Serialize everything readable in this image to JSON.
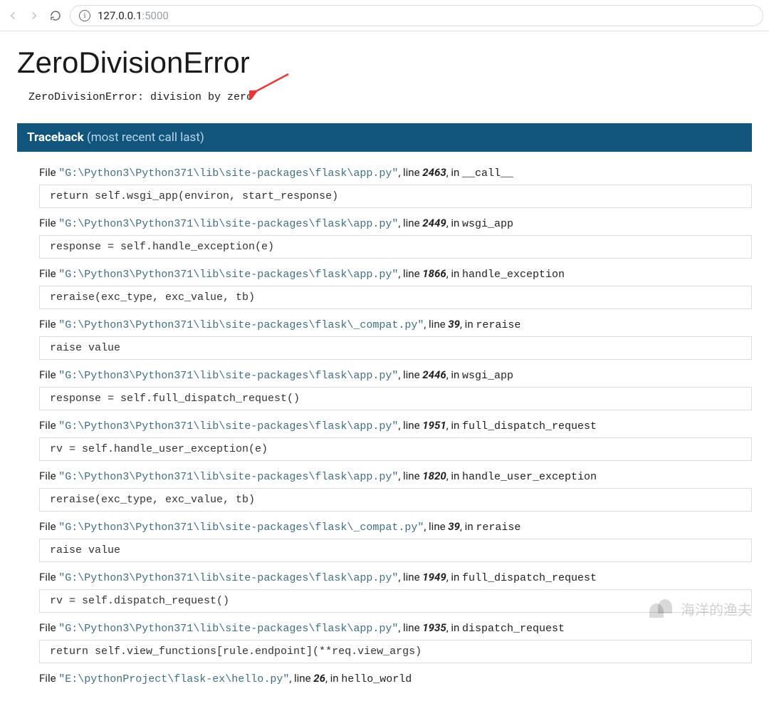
{
  "browser": {
    "url_host": "127.0.0.1",
    "url_port": ":5000"
  },
  "error": {
    "title": "ZeroDivisionError",
    "message": "ZeroDivisionError: division by zero"
  },
  "traceback": {
    "label": "Traceback",
    "paren": "(most recent call last)",
    "frames": [
      {
        "path": "\"G:\\Python3\\Python371\\lib\\site-packages\\flask\\app.py\"",
        "line": "2463",
        "func": "__call__",
        "code": "return self.wsgi_app(environ, start_response)"
      },
      {
        "path": "\"G:\\Python3\\Python371\\lib\\site-packages\\flask\\app.py\"",
        "line": "2449",
        "func": "wsgi_app",
        "code": "response = self.handle_exception(e)"
      },
      {
        "path": "\"G:\\Python3\\Python371\\lib\\site-packages\\flask\\app.py\"",
        "line": "1866",
        "func": "handle_exception",
        "code": "reraise(exc_type, exc_value, tb)"
      },
      {
        "path": "\"G:\\Python3\\Python371\\lib\\site-packages\\flask\\_compat.py\"",
        "line": "39",
        "func": "reraise",
        "code": "raise value"
      },
      {
        "path": "\"G:\\Python3\\Python371\\lib\\site-packages\\flask\\app.py\"",
        "line": "2446",
        "func": "wsgi_app",
        "code": "response = self.full_dispatch_request()"
      },
      {
        "path": "\"G:\\Python3\\Python371\\lib\\site-packages\\flask\\app.py\"",
        "line": "1951",
        "func": "full_dispatch_request",
        "code": "rv = self.handle_user_exception(e)"
      },
      {
        "path": "\"G:\\Python3\\Python371\\lib\\site-packages\\flask\\app.py\"",
        "line": "1820",
        "func": "handle_user_exception",
        "code": "reraise(exc_type, exc_value, tb)"
      },
      {
        "path": "\"G:\\Python3\\Python371\\lib\\site-packages\\flask\\_compat.py\"",
        "line": "39",
        "func": "reraise",
        "code": "raise value"
      },
      {
        "path": "\"G:\\Python3\\Python371\\lib\\site-packages\\flask\\app.py\"",
        "line": "1949",
        "func": "full_dispatch_request",
        "code": "rv = self.dispatch_request()"
      },
      {
        "path": "\"G:\\Python3\\Python371\\lib\\site-packages\\flask\\app.py\"",
        "line": "1935",
        "func": "dispatch_request",
        "code": "return self.view_functions[rule.endpoint](**req.view_args)"
      },
      {
        "path": "\"E:\\pythonProject\\flask-ex\\hello.py\"",
        "line": "26",
        "func": "hello_world",
        "code": ""
      }
    ]
  },
  "labels": {
    "file": "File ",
    "line_sep": ", line ",
    "in_sep": ", in "
  },
  "watermark": "海洋的渔夫"
}
